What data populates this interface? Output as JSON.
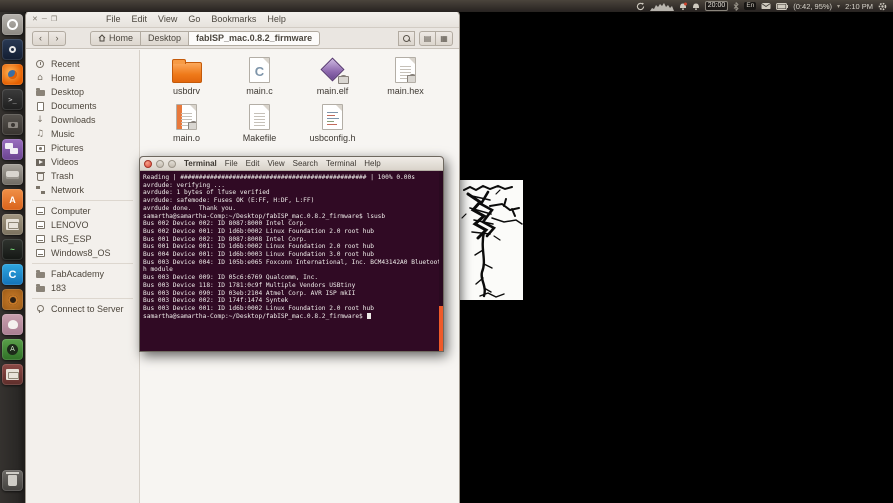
{
  "colors": {
    "terminal_background": "#300a24",
    "scrollbar_accent": "#ef5a29",
    "folder_orange": "#ef7a1a",
    "panel_background": "#2e2a26"
  },
  "panel": {
    "timer": "20:00",
    "keyboard_indicator": "En",
    "battery_text": "(0:42, 95%)",
    "clock": "2:10 PM"
  },
  "file_manager": {
    "window_controls": [
      "✕",
      "─",
      "❐"
    ],
    "menus": [
      "File",
      "Edit",
      "View",
      "Go",
      "Bookmarks",
      "Help"
    ],
    "nav": {
      "back": "‹",
      "forward": "›"
    },
    "breadcrumbs": {
      "home": "Home",
      "parent": "Desktop",
      "current": "fabISP_mac.0.8.2_firmware"
    },
    "view_toggles": [
      "▤",
      "▦"
    ],
    "sidebar": {
      "items": [
        "Recent",
        "Home",
        "Desktop",
        "Documents",
        "Downloads",
        "Music",
        "Pictures",
        "Videos",
        "Trash",
        "Network",
        "Computer",
        "LENOVO",
        "LRS_ESP",
        "Windows8_OS",
        "FabAcademy",
        "183",
        "Connect to Server"
      ]
    },
    "files": [
      {
        "name": "usbdrv"
      },
      {
        "name": "main.c"
      },
      {
        "name": "main.elf"
      },
      {
        "name": "main.hex"
      },
      {
        "name": "main.o"
      },
      {
        "name": "Makefile"
      },
      {
        "name": "usbconfig.h"
      }
    ]
  },
  "terminal": {
    "title": "Terminal",
    "menus": [
      "File",
      "Edit",
      "View",
      "Search",
      "Terminal",
      "Help"
    ],
    "lines": [
      "Reading | ################################################## | 100% 0.00s",
      "",
      "avrdude: verifying ...",
      "avrdude: 1 bytes of lfuse verified",
      "",
      "avrdude: safemode: Fuses OK (E:FF, H:DF, L:FF)",
      "",
      "avrdude done.  Thank you.",
      "",
      "samartha@samartha-Comp:~/Desktop/fabISP_mac.0.8.2_firmware$ lsusb",
      "Bus 002 Device 002: ID 8087:8000 Intel Corp.",
      "Bus 002 Device 001: ID 1d6b:0002 Linux Foundation 2.0 root hub",
      "Bus 001 Device 002: ID 8087:8008 Intel Corp.",
      "Bus 001 Device 001: ID 1d6b:0002 Linux Foundation 2.0 root hub",
      "Bus 004 Device 001: ID 1d6b:0003 Linux Foundation 3.0 root hub",
      "Bus 003 Device 004: ID 105b:e065 Foxconn International, Inc. BCM43142A0 Bluetoot",
      "h module",
      "Bus 003 Device 009: ID 05c6:6769 Qualcomm, Inc.",
      "Bus 003 Device 118: ID 1781:0c9f Multiple Vendors USBtiny",
      "Bus 003 Device 090: ID 03eb:2104 Atmel Corp. AVR ISP mkII",
      "Bus 003 Device 002: ID 174f:1474 Syntek",
      "Bus 003 Device 001: ID 1d6b:0002 Linux Foundation 2.0 root hub",
      "samartha@samartha-Comp:~/Desktop/fabISP_mac.0.8.2_firmware$ "
    ]
  },
  "launcher": {
    "icons": [
      "ubuntu-dash",
      "steam",
      "firefox",
      "terminal",
      "screenshot-tool",
      "purple-app",
      "disk-utility",
      "ubuntu-software-center",
      "file-cabinet",
      "system-monitor",
      "c-app",
      "team-fortress-2",
      "pink-app",
      "green-a-app",
      "maroon-cabinet",
      "trash"
    ],
    "software_center_letter": "A",
    "terminal_glyph": ">_",
    "monitor_glyph": "~",
    "c_app_letter": "C",
    "green_badge_letter": "A"
  }
}
